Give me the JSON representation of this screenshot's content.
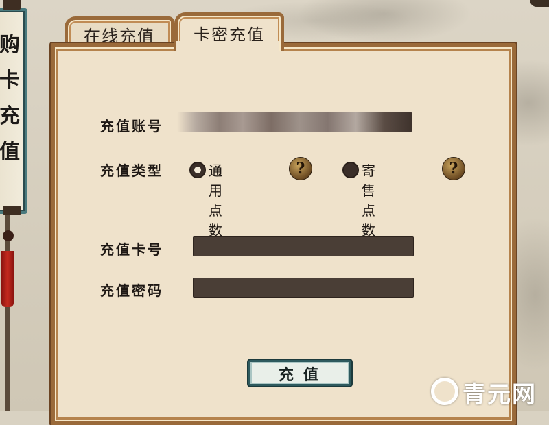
{
  "scroll": {
    "title": "购卡充值",
    "visible_glyphs": [
      "购",
      "卡",
      "充",
      "值"
    ]
  },
  "tabs": [
    {
      "label": "在线充值",
      "active": false
    },
    {
      "label": "卡密充值",
      "active": true
    }
  ],
  "form": {
    "account_label": "充值账号",
    "account_value": "",
    "type_label": "充值类型",
    "type_options": [
      {
        "label": "通用点数",
        "selected": true
      },
      {
        "label": "寄售点数",
        "selected": false
      }
    ],
    "card_number_label": "充值卡号",
    "card_number_value": "",
    "card_password_label": "充值密码",
    "card_password_value": "",
    "help_glyph": "?"
  },
  "submit_label": "充值",
  "watermark": {
    "text": "青元网"
  },
  "colors": {
    "frame": "#9a6a3a",
    "panel": "#efe2cb",
    "field": "#4a3e36",
    "button_border": "#2e5a5e",
    "tassel": "#c42a1e"
  }
}
